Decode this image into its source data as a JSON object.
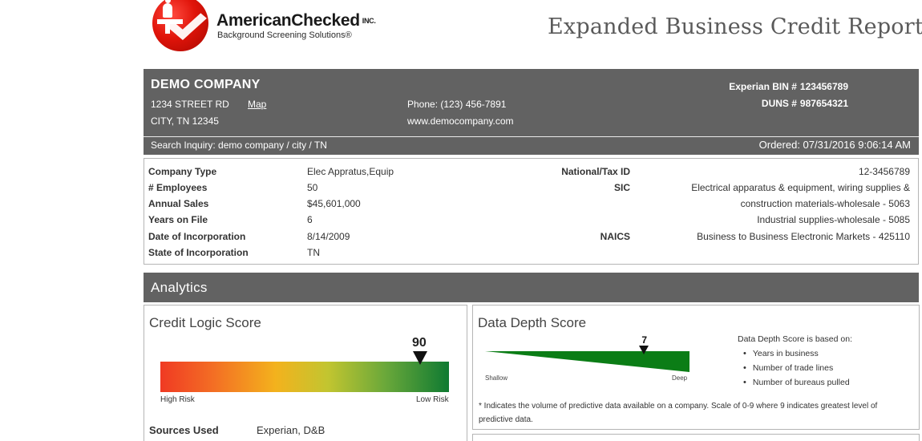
{
  "logo": {
    "name": "AmericanChecked",
    "suffix": "INC.",
    "tagline": "Background Screening Solutions®"
  },
  "report_title": "Expanded Business Credit Report",
  "company": {
    "name": "DEMO COMPANY",
    "address_line1": "1234 STREET RD",
    "map_link": "Map",
    "address_line2": "CITY, TN 12345",
    "phone": "Phone: (123) 456-7891",
    "website": "www.democompany.com",
    "bin_label": "Experian BIN #",
    "bin_value": "123456789",
    "duns_label": "DUNS #",
    "duns_value": "987654321",
    "search_inquiry": "Search Inquiry: demo company / city / TN",
    "ordered": "Ordered: 07/31/2016 9:06:14 AM"
  },
  "info_left": [
    {
      "label": "Company Type",
      "value": "Elec Appratus,Equip"
    },
    {
      "label": "# Employees",
      "value": "50"
    },
    {
      "label": "Annual Sales",
      "value": "$45,601,000"
    },
    {
      "label": "Years on File",
      "value": "6"
    },
    {
      "label": "Date of Incorporation",
      "value": "8/14/2009"
    },
    {
      "label": "State of Incorporation",
      "value": "TN"
    }
  ],
  "info_right": {
    "tax_label": "National/Tax ID",
    "tax_value": "12-3456789",
    "sic_label": "SIC",
    "sic_lines": [
      "Electrical apparatus & equipment, wiring supplies &",
      "construction materials-wholesale - 5063",
      "Industrial supplies-wholesale - 5085"
    ],
    "naics_label": "NAICS",
    "naics_value": "Business to Business Electronic Markets - 425110"
  },
  "analytics": {
    "title": "Analytics",
    "credit_logic": {
      "title": "Credit Logic Score",
      "score": "90",
      "score_fraction": 0.9,
      "low_label": "High Risk",
      "high_label": "Low Risk",
      "sources_label": "Sources Used",
      "sources_value": "Experian, D&B"
    },
    "data_depth": {
      "title": "Data Depth Score",
      "score": "7",
      "score_fraction": 0.7778,
      "shallow_label": "Shallow",
      "deep_label": "Deep",
      "basis_title": "Data Depth Score is based on:",
      "basis_items": [
        "Years in business",
        "Number of trade lines",
        "Number of bureaus pulled"
      ],
      "footnote": "* Indicates the volume of predictive data available on a company. Scale of 0-9 where 9 indicates greatest level of predictive data."
    }
  },
  "colors": {
    "header_bg": "#626262",
    "border": "#b5b5b5",
    "gauge_low": "#f03a23",
    "gauge_high": "#0f7a32",
    "depth_fill": "#0b7d16"
  }
}
